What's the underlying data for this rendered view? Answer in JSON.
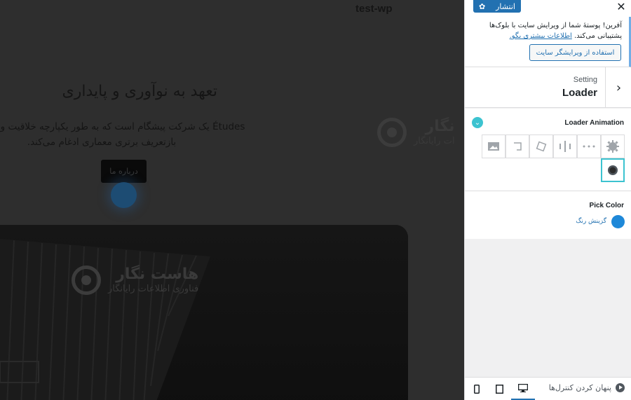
{
  "preview": {
    "site_title": "test-wp",
    "hero_heading": "تعهد به نوآوری و پایداری",
    "hero_line1": "Études یک شرکت پیشگام است که به طور یکپارچه خلاقیت و عملکرد را",
    "hero_line2": "بازتعریف برتری معماری ادغام می‌کند.",
    "about_button": "درباره ما",
    "watermark_brand": "هاست نگار",
    "watermark_sub": "فناوری اطلاعات رایانگار",
    "watermark_brand_partial": "نگار",
    "watermark_sub_partial": "ات رایانگار"
  },
  "panel": {
    "publish_label": "انتشار",
    "notice_text": "آفرین! پوستهٔ شما از ویرایش سایت با بلوک‌ها پشتیبانی می‌کند.",
    "notice_link": "اطلاعات بیشتری بگو.",
    "site_editor_button": "استفاده از ویرایشگر سایت",
    "breadcrumb": "Setting",
    "section_title": "Loader",
    "loader_animation_label": "Loader Animation",
    "pick_color_label": "Pick Color",
    "color_picker_label": "گزینش رنگ",
    "hide_controls": "پنهان کردن کنترل‌ها",
    "accent_color": "#2271b1",
    "selected_color": "#1e88d8",
    "loader_options": [
      "gear-icon",
      "dots-icon",
      "bars-icon",
      "rotated-square-icon",
      "bracket-icon",
      "image-icon",
      "ring-icon"
    ]
  }
}
